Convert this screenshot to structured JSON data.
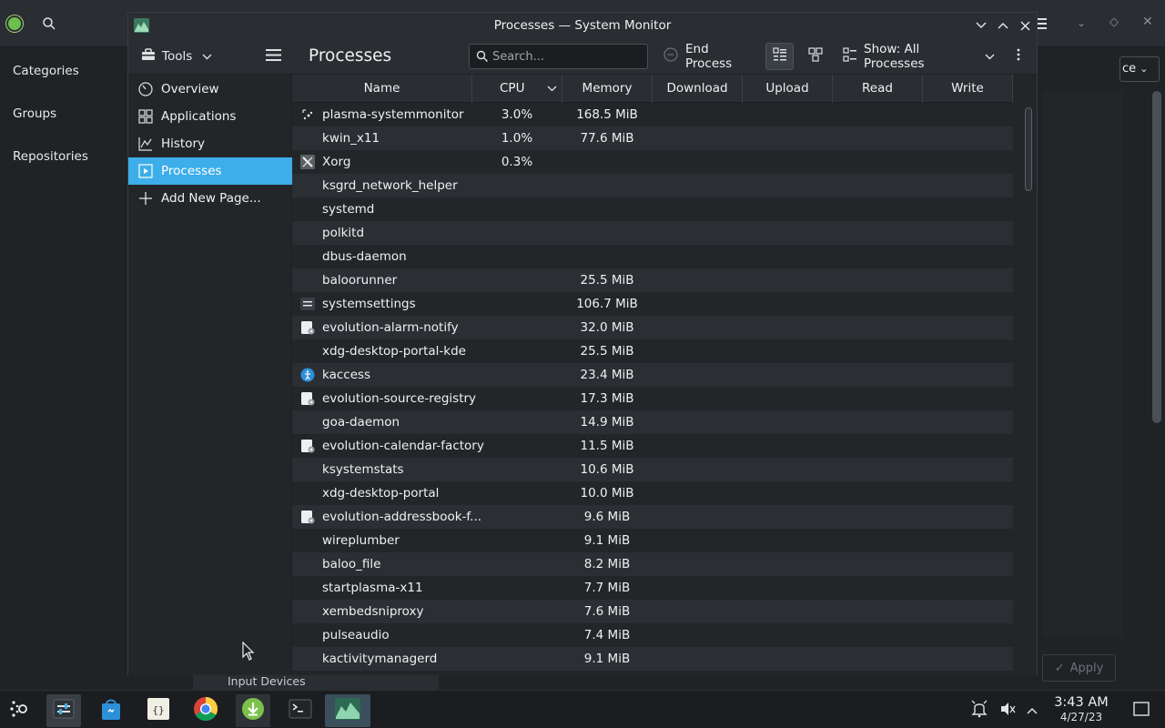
{
  "background_app": {
    "nav": [
      "Categories",
      "Groups",
      "Repositories"
    ],
    "combo_text": "ce",
    "apply_label": "Apply",
    "input_devices_label": "Input Devices"
  },
  "window": {
    "title": "Processes — System Monitor"
  },
  "toolbar": {
    "tools_label": "Tools",
    "page_title": "Processes",
    "search_placeholder": "Search...",
    "end_process_label": "End Process",
    "show_label": "Show: All Processes"
  },
  "nav": {
    "items": [
      {
        "label": "Overview",
        "icon": "gauge-icon"
      },
      {
        "label": "Applications",
        "icon": "grid-icon"
      },
      {
        "label": "History",
        "icon": "chart-icon"
      },
      {
        "label": "Processes",
        "icon": "processes-icon",
        "active": true
      },
      {
        "label": "Add New Page...",
        "icon": "plus-icon"
      }
    ]
  },
  "table": {
    "columns": [
      "Name",
      "CPU",
      "Memory",
      "Download",
      "Upload",
      "Read",
      "Write"
    ],
    "sort_column": "CPU",
    "rows": [
      {
        "name": "plasma-systemmonitor",
        "cpu": "3.0%",
        "memory": "168.5 MiB",
        "icon": "monitor-icon"
      },
      {
        "name": "kwin_x11",
        "cpu": "1.0%",
        "memory": "77.6 MiB",
        "icon": ""
      },
      {
        "name": "Xorg",
        "cpu": "0.3%",
        "memory": "",
        "icon": "xorg-icon"
      },
      {
        "name": "ksgrd_network_helper",
        "cpu": "",
        "memory": "",
        "icon": ""
      },
      {
        "name": "systemd",
        "cpu": "",
        "memory": "",
        "icon": ""
      },
      {
        "name": "polkitd",
        "cpu": "",
        "memory": "",
        "icon": ""
      },
      {
        "name": "dbus-daemon",
        "cpu": "",
        "memory": "",
        "icon": ""
      },
      {
        "name": "baloorunner",
        "cpu": "",
        "memory": "25.5 MiB",
        "icon": ""
      },
      {
        "name": "systemsettings",
        "cpu": "",
        "memory": "106.7 MiB",
        "icon": "settings-icon"
      },
      {
        "name": "evolution-alarm-notify",
        "cpu": "",
        "memory": "32.0 MiB",
        "icon": "evolution-icon"
      },
      {
        "name": "xdg-desktop-portal-kde",
        "cpu": "",
        "memory": "25.5 MiB",
        "icon": ""
      },
      {
        "name": "kaccess",
        "cpu": "",
        "memory": "23.4 MiB",
        "icon": "accessibility-icon"
      },
      {
        "name": "evolution-source-registry",
        "cpu": "",
        "memory": "17.3 MiB",
        "icon": "evolution-icon"
      },
      {
        "name": "goa-daemon",
        "cpu": "",
        "memory": "14.9 MiB",
        "icon": ""
      },
      {
        "name": "evolution-calendar-factory",
        "cpu": "",
        "memory": "11.5 MiB",
        "icon": "evolution-icon"
      },
      {
        "name": "ksystemstats",
        "cpu": "",
        "memory": "10.6 MiB",
        "icon": ""
      },
      {
        "name": "xdg-desktop-portal",
        "cpu": "",
        "memory": "10.0 MiB",
        "icon": ""
      },
      {
        "name": "evolution-addressbook-f...",
        "cpu": "",
        "memory": "9.6 MiB",
        "icon": "evolution-icon"
      },
      {
        "name": "wireplumber",
        "cpu": "",
        "memory": "9.1 MiB",
        "icon": ""
      },
      {
        "name": "baloo_file",
        "cpu": "",
        "memory": "8.2 MiB",
        "icon": ""
      },
      {
        "name": "startplasma-x11",
        "cpu": "",
        "memory": "7.7 MiB",
        "icon": ""
      },
      {
        "name": "xembedsniproxy",
        "cpu": "",
        "memory": "7.6 MiB",
        "icon": ""
      },
      {
        "name": "pulseaudio",
        "cpu": "",
        "memory": "7.4 MiB",
        "icon": ""
      },
      {
        "name": "kactivitymanagerd",
        "cpu": "",
        "memory": "9.1 MiB",
        "icon": ""
      }
    ]
  },
  "taskbar": {
    "time": "3:43 AM",
    "date": "4/27/23"
  },
  "colors": {
    "accent": "#3daee9",
    "window_bg": "#232629",
    "header_bg": "#2a2e32",
    "alt_row": "#2b2f33"
  }
}
